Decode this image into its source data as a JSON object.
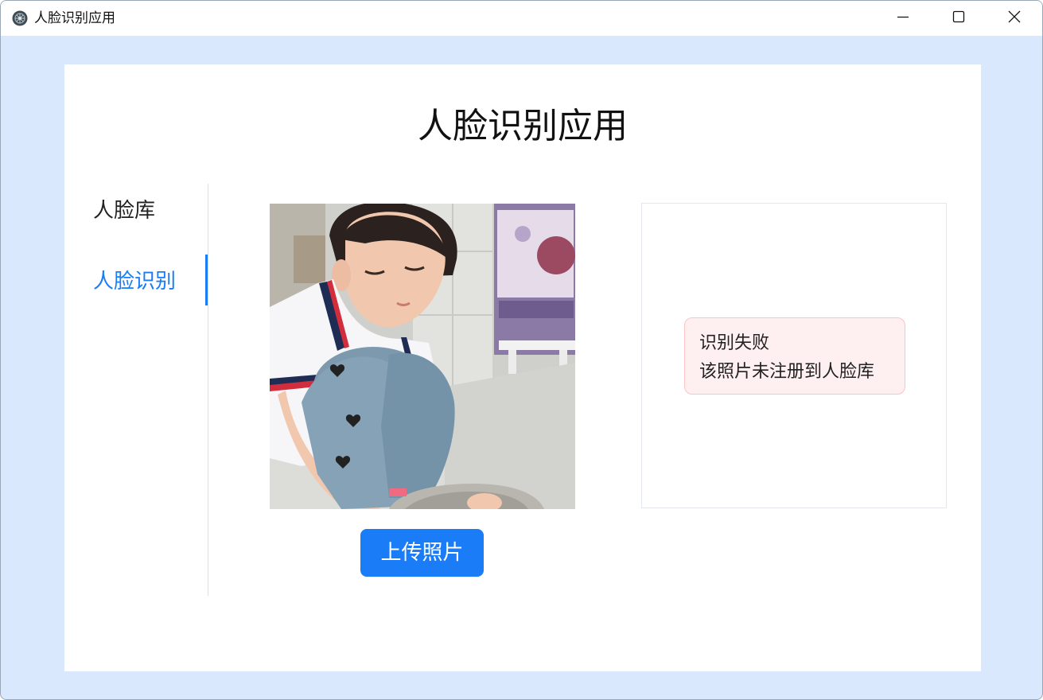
{
  "window": {
    "title": "人脸识别应用",
    "controls": {
      "minimize_icon": "minimize-icon",
      "maximize_icon": "maximize-icon",
      "close_icon": "close-icon"
    }
  },
  "page": {
    "title": "人脸识别应用"
  },
  "sidebar": {
    "items": [
      {
        "label": "人脸库",
        "active": false
      },
      {
        "label": "人脸识别",
        "active": true
      }
    ]
  },
  "main": {
    "photo": {
      "icon": "uploaded-photo"
    },
    "upload_label": "上传照片"
  },
  "result": {
    "title": "识别失败",
    "message": "该照片未注册到人脸库"
  },
  "colors": {
    "accent": "#1a7cf6",
    "window_bg": "#d9e8fc",
    "alert_bg": "#fef0f0",
    "alert_border": "#fbc4c4"
  }
}
